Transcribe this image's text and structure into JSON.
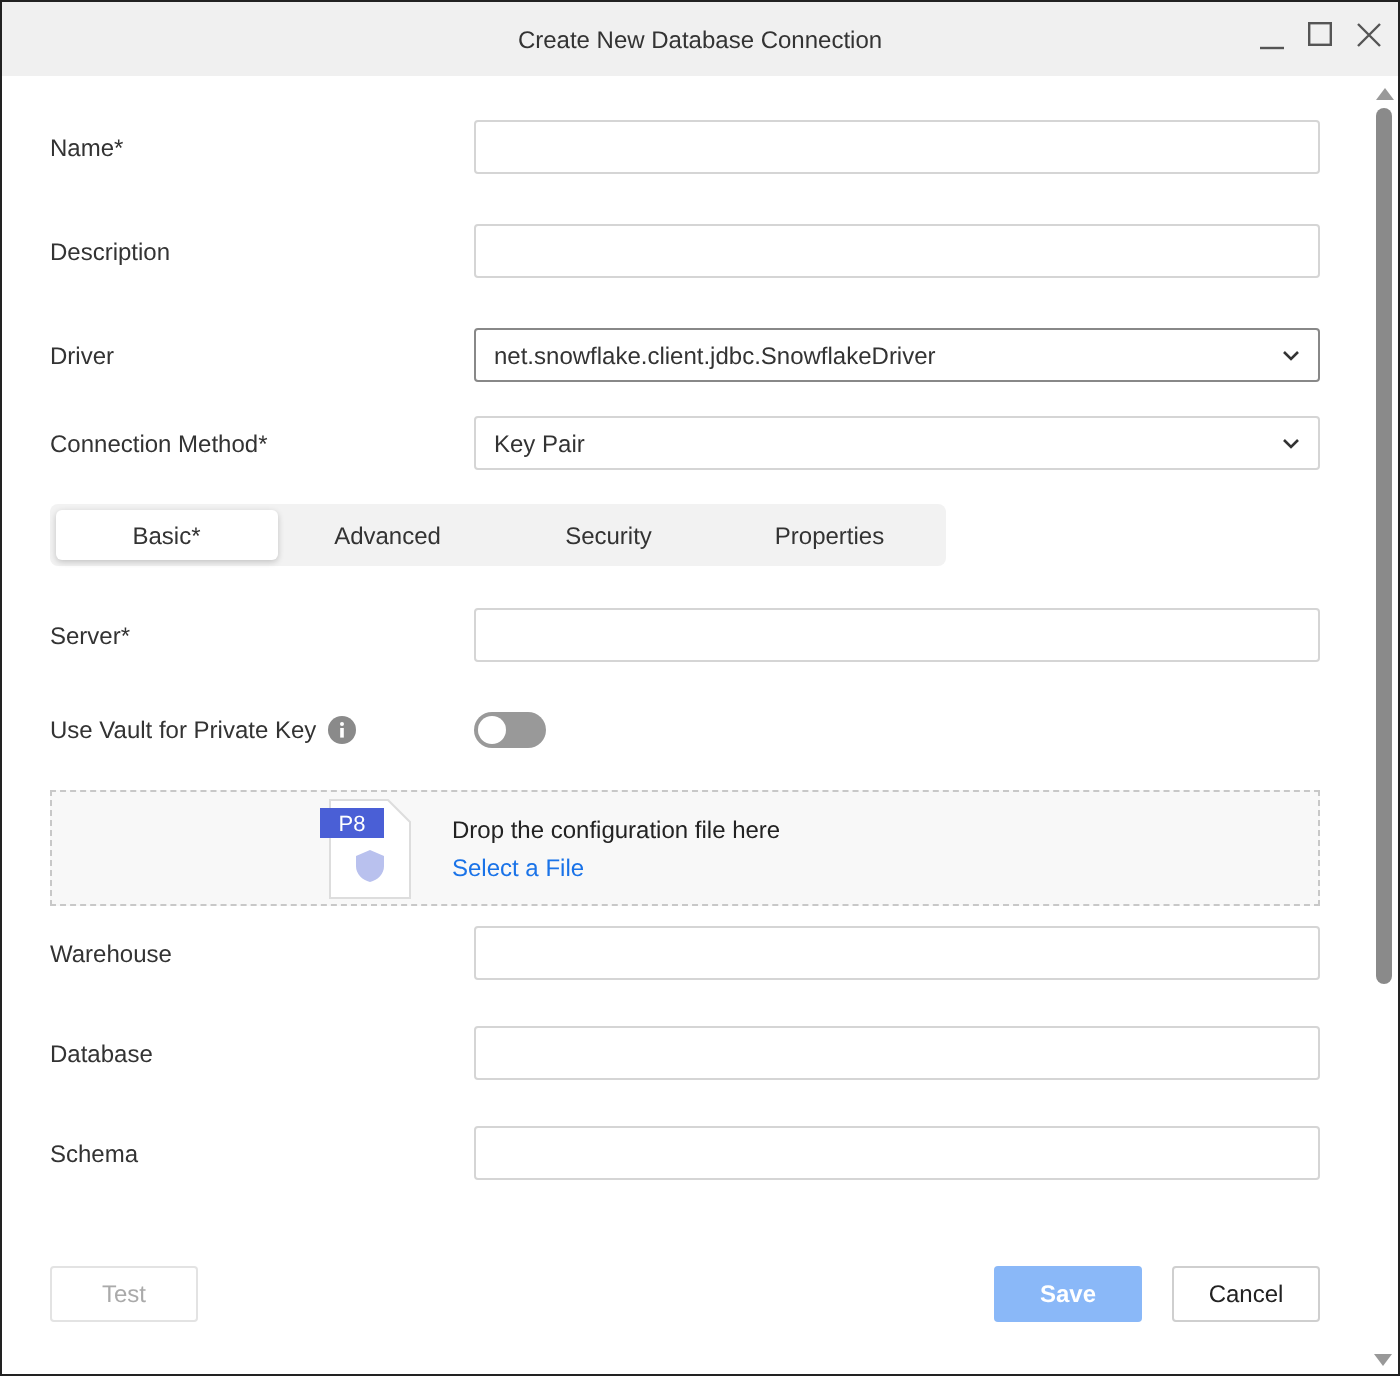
{
  "window": {
    "title": "Create New Database Connection"
  },
  "fields_top": [
    {
      "label": "Name*",
      "kind": "text"
    },
    {
      "label": "Description",
      "kind": "text"
    },
    {
      "label": "Driver",
      "kind": "select",
      "value": "net.snowflake.client.jdbc.SnowflakeDriver"
    },
    {
      "label": "Connection Method*",
      "kind": "select",
      "value": "Key Pair"
    }
  ],
  "tabs": [
    {
      "label": "Basic*",
      "selected": true
    },
    {
      "label": "Advanced",
      "selected": false
    },
    {
      "label": "Security",
      "selected": false
    },
    {
      "label": "Properties",
      "selected": false
    }
  ],
  "server": {
    "label": "Server*"
  },
  "vault": {
    "label": "Use Vault for Private Key",
    "on": false
  },
  "dropzone": {
    "badge": "P8",
    "text": "Drop the configuration file here",
    "link": "Select a File"
  },
  "fields_bottom": [
    {
      "label": "Warehouse"
    },
    {
      "label": "Database"
    },
    {
      "label": "Schema"
    }
  ],
  "footer": {
    "test": {
      "label": "Test",
      "disabled": true
    },
    "save": {
      "label": "Save",
      "disabled": true
    },
    "cancel": {
      "label": "Cancel"
    }
  }
}
